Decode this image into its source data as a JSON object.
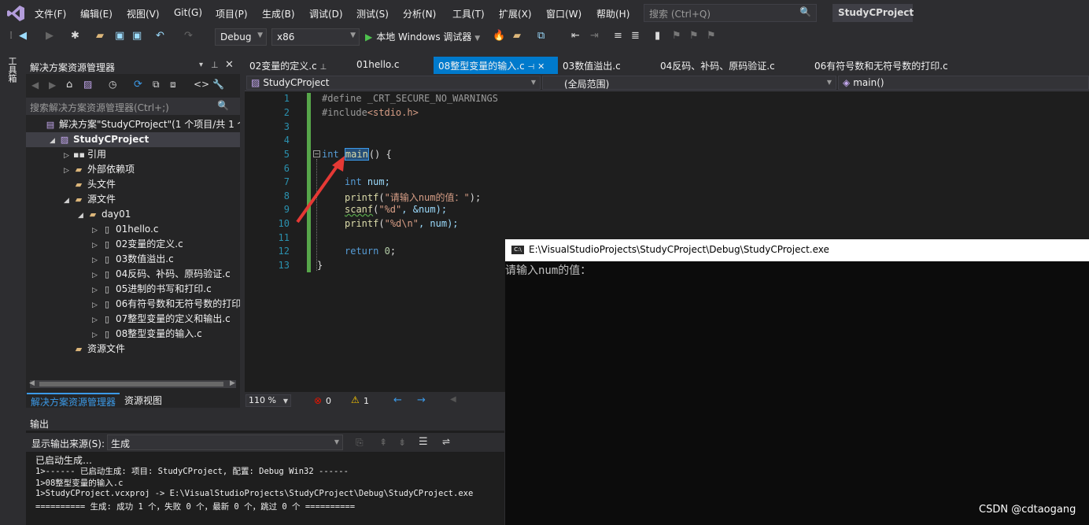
{
  "menubar": {
    "items": [
      "文件(F)",
      "编辑(E)",
      "视图(V)",
      "Git(G)",
      "项目(P)",
      "生成(B)",
      "调试(D)",
      "测试(S)",
      "分析(N)",
      "工具(T)",
      "扩展(X)",
      "窗口(W)",
      "帮助(H)"
    ],
    "search_placeholder": "搜索 (Ctrl+Q)",
    "project_badge": "StudyCProject"
  },
  "toolbar": {
    "config": "Debug",
    "platform": "x86",
    "run_label": "本地 Windows 调试器"
  },
  "left_tab": "工具箱",
  "solution_explorer": {
    "title": "解决方案资源管理器",
    "search_placeholder": "搜索解决方案资源管理器(Ctrl+;)",
    "tree": [
      {
        "label": "解决方案\"StudyCProject\"(1 个项目/共 1 个)",
        "indent": 0,
        "icon": "solution-icon"
      },
      {
        "label": "StudyCProject",
        "indent": 1,
        "icon": "project-icon",
        "bold": true
      },
      {
        "label": "引用",
        "indent": 2,
        "icon": "references-icon"
      },
      {
        "label": "外部依赖项",
        "indent": 2,
        "icon": "folder-icon"
      },
      {
        "label": "头文件",
        "indent": 2,
        "icon": "folder-icon"
      },
      {
        "label": "源文件",
        "indent": 2,
        "icon": "folder-icon"
      },
      {
        "label": "day01",
        "indent": 3,
        "icon": "folder-icon"
      },
      {
        "label": "01hello.c",
        "indent": 4,
        "icon": "c-file-icon"
      },
      {
        "label": "02变量的定义.c",
        "indent": 4,
        "icon": "c-file-icon"
      },
      {
        "label": "03数值溢出.c",
        "indent": 4,
        "icon": "c-file-icon"
      },
      {
        "label": "04反码、补码、原码验证.c",
        "indent": 4,
        "icon": "c-file-icon"
      },
      {
        "label": "05进制的书写和打印.c",
        "indent": 4,
        "icon": "c-file-icon"
      },
      {
        "label": "06有符号数和无符号数的打印.c",
        "indent": 4,
        "icon": "c-file-icon"
      },
      {
        "label": "07整型变量的定义和输出.c",
        "indent": 4,
        "icon": "c-file-icon"
      },
      {
        "label": "08整型变量的输入.c",
        "indent": 4,
        "icon": "c-file-icon"
      },
      {
        "label": "资源文件",
        "indent": 2,
        "icon": "folder-icon"
      }
    ],
    "tabs": [
      "解决方案资源管理器",
      "资源视图"
    ]
  },
  "doc_tabs": [
    "02变量的定义.c",
    "01hello.c",
    "08整型变量的输入.c",
    "03数值溢出.c",
    "04反码、补码、原码验证.c",
    "06有符号数和无符号数的打印.c"
  ],
  "nav_bar": {
    "project": "StudyCProject",
    "scope": "(全局范围)",
    "member": "main()"
  },
  "code": {
    "line_numbers": [
      "1",
      "2",
      "3",
      "4",
      "5",
      "6",
      "7",
      "8",
      "9",
      "10",
      "11",
      "12",
      "13"
    ],
    "l1": "#define _CRT_SECURE_NO_WARNINGS",
    "l2a": "#include",
    "l2b": "<stdio.h>",
    "l5a": "int",
    "l5b": "main",
    "l5c": "() {",
    "l7a": "int",
    "l7b": "num;",
    "l8a": "printf",
    "l8b": "(",
    "l8c": "\"请输入num的值：\"",
    "l8d": ");",
    "l9a": "scanf",
    "l9b": "(",
    "l9c": "\"%d\"",
    "l9d": ", &num);",
    "l10a": "printf",
    "l10b": "(",
    "l10c": "\"%d\\n\"",
    "l10d": ", num);",
    "l12a": "return",
    "l12b": "0",
    "l12c": ";",
    "l13": "}"
  },
  "editor_status": {
    "zoom": "110 %",
    "errors": "0",
    "warnings": "1"
  },
  "output": {
    "title": "输出",
    "source_label": "显示输出来源(S):",
    "source_value": "生成",
    "lines": [
      "已启动生成…",
      "1>------ 已启动生成: 项目: StudyCProject, 配置: Debug Win32 ------",
      "1>08整型变量的输入.c",
      "1>StudyCProject.vcxproj -> E:\\VisualStudioProjects\\StudyCProject\\Debug\\StudyCProject.exe",
      "========== 生成: 成功 1 个，失败 0 个，最新 0 个，跳过 0 个 =========="
    ]
  },
  "console": {
    "title": "E:\\VisualStudioProjects\\StudyCProject\\Debug\\StudyCProject.exe",
    "text": "请输入num的值："
  },
  "watermark": "CSDN @cdtaogang",
  "colors": {
    "accent": "#007acc",
    "bg": "#2d2d30",
    "editor": "#1e1e1e"
  }
}
